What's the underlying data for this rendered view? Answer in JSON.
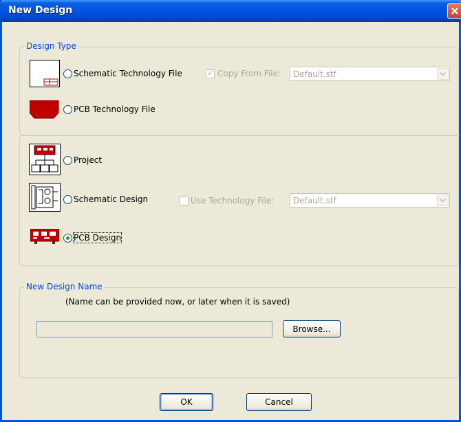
{
  "window": {
    "title": "New Design"
  },
  "design_type": {
    "label": "Design Type",
    "schematic_tech": {
      "label": "Schematic Technology File",
      "selected": false
    },
    "copy_from_file": {
      "label": "Copy From File:",
      "checked": true,
      "enabled": false,
      "value": "Default.stf"
    },
    "pcb_tech": {
      "label": "PCB Technology File",
      "selected": false
    }
  },
  "design_kind": {
    "project": {
      "label": "Project",
      "selected": false
    },
    "schematic_design": {
      "label": "Schematic Design",
      "selected": false
    },
    "use_tech_file": {
      "label": "Use Technology File:",
      "checked": false,
      "enabled": false,
      "value": "Default.stf"
    },
    "pcb_design": {
      "label": "PCB Design",
      "selected": true
    }
  },
  "new_design_name": {
    "label": "New Design Name",
    "hint": "(Name can be provided now, or later when it is saved)",
    "value": "",
    "browse_label": "Browse..."
  },
  "buttons": {
    "ok": "OK",
    "cancel": "Cancel"
  },
  "colors": {
    "title_bar": "#0054e3",
    "group_label": "#0046d5",
    "pcb_red": "#c00000",
    "radio_dot": "#21a121"
  },
  "icons": [
    "close-icon",
    "schematic-tech-file-icon",
    "pcb-tech-file-icon",
    "project-icon",
    "schematic-design-icon",
    "pcb-design-icon",
    "dropdown-arrow-icon"
  ]
}
